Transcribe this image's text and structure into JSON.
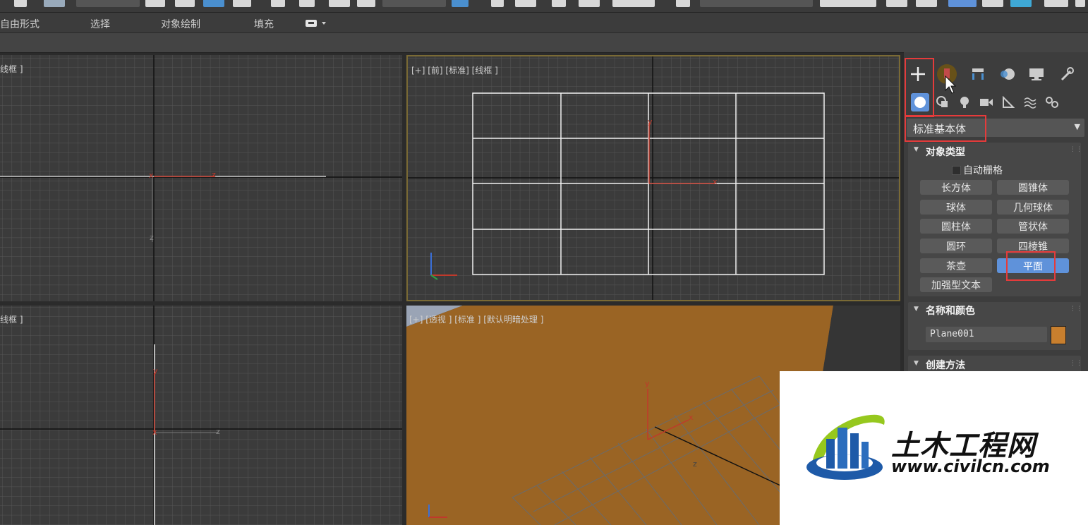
{
  "ribbon": {
    "tabs": [
      "自由形式",
      "选择",
      "对象绘制",
      "填充"
    ],
    "dropdown_icon": "display-icon"
  },
  "viewports": {
    "top_left": {
      "label": "线框 ]"
    },
    "front": {
      "label": "[+] [前] [标准] [线框 ]"
    },
    "bottom_left": {
      "label": "线框 ]"
    },
    "perspective": {
      "label": "[+] [透视 ] [标准 ] [默认明暗处理 ]",
      "plane_color": "#9a6424"
    }
  },
  "axes": {
    "x": "x",
    "y": "y",
    "z": "z"
  },
  "command_panel": {
    "tabs": [
      "create-icon",
      "modify-icon",
      "hierarchy-icon",
      "motion-icon",
      "display-icon",
      "utilities-icon"
    ],
    "subcategories": [
      "geometry-icon",
      "shapes-icon",
      "lights-icon",
      "cameras-icon",
      "helpers-icon",
      "spacewarps-icon",
      "systems-icon"
    ],
    "category_dropdown": "标准基本体",
    "object_type": {
      "title": "对象类型",
      "autogrid_label": "自动栅格",
      "buttons": [
        "长方体",
        "圆锥体",
        "球体",
        "几何球体",
        "圆柱体",
        "管状体",
        "圆环",
        "四棱锥",
        "茶壶",
        "平面",
        "加强型文本"
      ],
      "active": "平面"
    },
    "name_color": {
      "title": "名称和颜色",
      "name_value": "Plane001",
      "color": "#c87f2e"
    },
    "creation_method": {
      "title": "创建方法"
    }
  },
  "watermark": {
    "brand": "土木工程网",
    "url": "www.civilcn.com"
  },
  "colors": {
    "highlight_red": "#e53b3b",
    "active_button": "#5f92da",
    "active_viewport_border": "#7a6a35"
  }
}
